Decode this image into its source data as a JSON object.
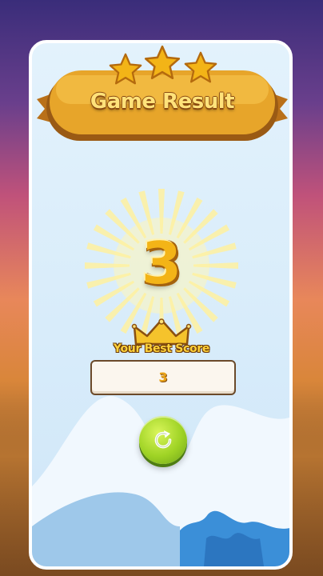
{
  "result_title": "Game Result",
  "score": "3",
  "best_score_label": "Your Best Score",
  "best_score_value": "3",
  "stars_earned": 3,
  "icons": {
    "replay": "replay-icon",
    "crown": "crown-icon",
    "star": "star-icon"
  },
  "colors": {
    "banner": "#e7a52a",
    "score": "#f3b417",
    "replay_button": "#9fd325",
    "panel": "#e3f2fc"
  }
}
